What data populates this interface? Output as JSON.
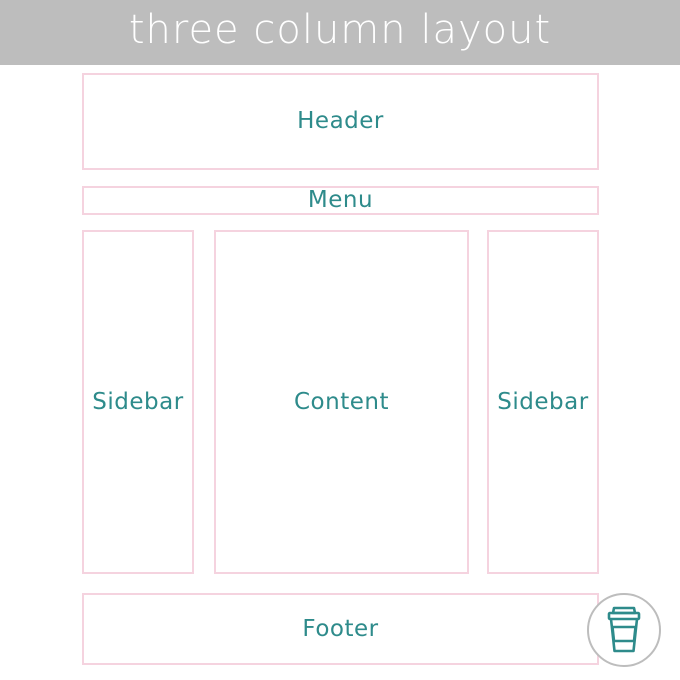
{
  "title": "three column layout",
  "boxes": {
    "header": "Header",
    "menu": "Menu",
    "sidebar_left": "Sidebar",
    "content": "Content",
    "sidebar_right": "Sidebar",
    "footer": "Footer"
  },
  "colors": {
    "title_bar": "#bdbdbd",
    "box_border": "#f5d3df",
    "label_text": "#2e8b8b",
    "badge_border": "#bdbdbd"
  },
  "icons": {
    "badge": "coffee-cup-icon"
  }
}
